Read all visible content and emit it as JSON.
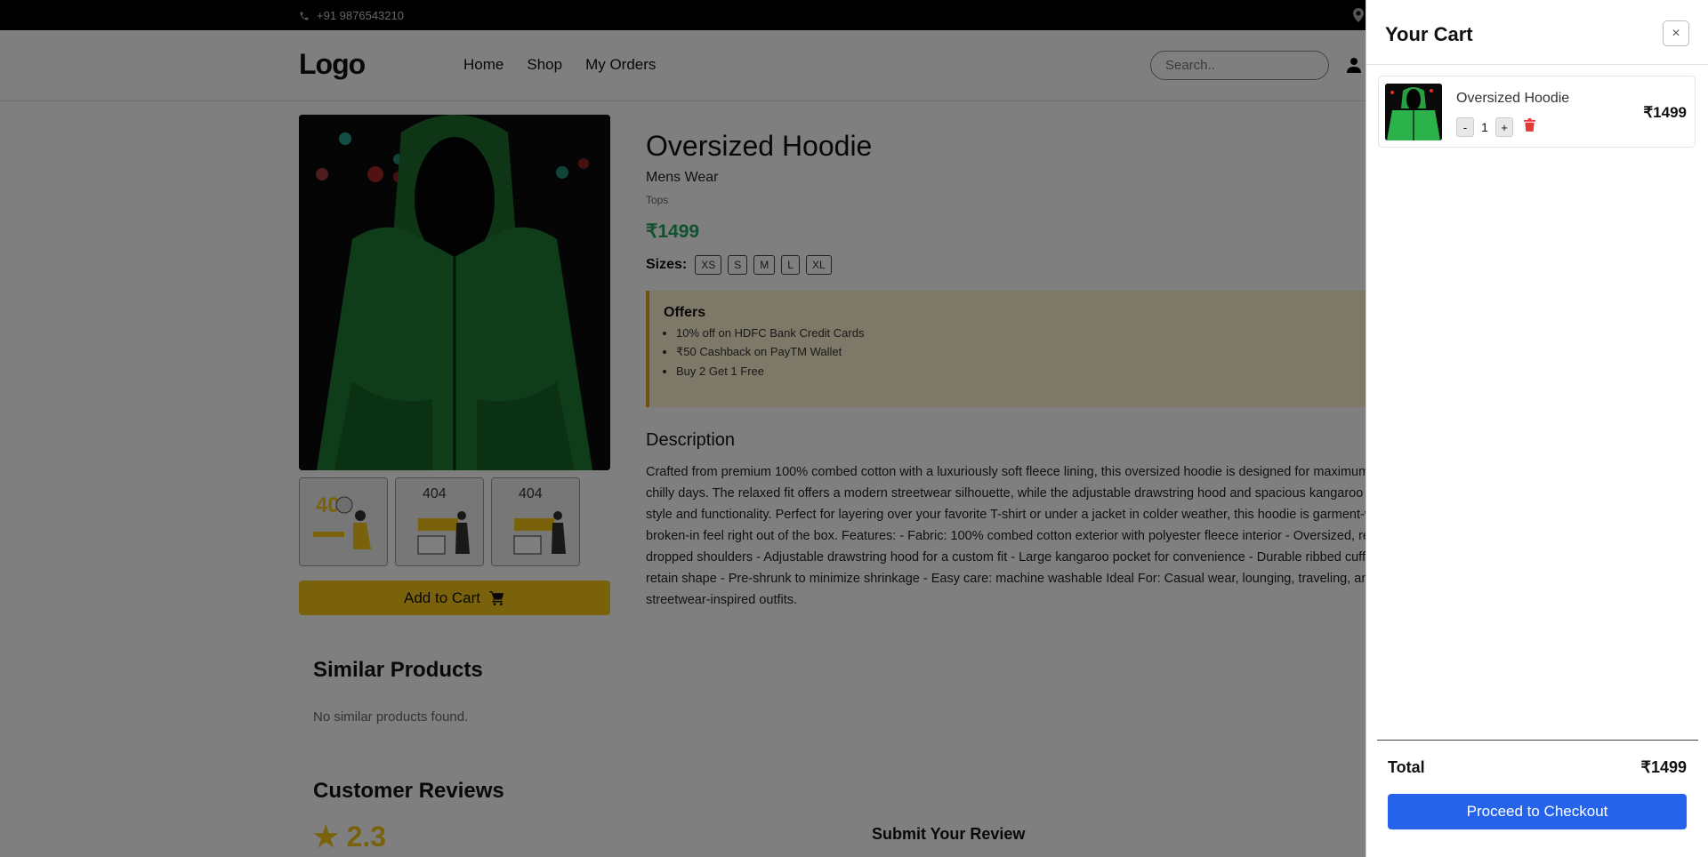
{
  "topbar": {
    "phone": "+91 9876543210"
  },
  "header": {
    "logo": "Logo",
    "nav": [
      "Home",
      "Shop",
      "My Orders"
    ],
    "search_placeholder": "Search.."
  },
  "product": {
    "title": "Oversized Hoodie",
    "category": "Mens Wear",
    "subcategory": "Tops",
    "price": "₹1499",
    "sizes_label": "Sizes:",
    "sizes": [
      "XS",
      "S",
      "M",
      "L",
      "XL"
    ],
    "add_to_cart": "Add to Cart",
    "offers_title": "Offers",
    "offers": [
      "10% off on HDFC Bank Credit Cards",
      "₹50 Cashback on PayTM Wallet",
      "Buy 2 Get 1 Free"
    ],
    "description_title": "Description",
    "description": "Crafted from premium 100% combed cotton with a luxuriously soft fleece lining, this oversized hoodie is designed for maximum comfort during chilly days. The relaxed fit offers a modern streetwear silhouette, while the adjustable drawstring hood and spacious kangaroo pocket add both style and functionality. Perfect for layering over your favorite T-shirt or under a jacket in colder weather, this hoodie is garment-washed for a broken-in feel right out of the box. Features: - Fabric: 100% combed cotton exterior with polyester fleece interior - Oversized, relaxed fit with dropped shoulders - Adjustable drawstring hood for a custom fit - Large kangaroo pocket for convenience - Durable ribbed cuffs and hem to retain shape - Pre-shrunk to minimize shrinkage - Easy care: machine washable Ideal For: Casual wear, lounging, traveling, and layering for streetwear-inspired outfits."
  },
  "similar": {
    "title": "Similar Products",
    "empty": "No similar products found."
  },
  "reviews": {
    "title": "Customer Reviews",
    "rating": "2.3",
    "submit_title": "Submit Your Review"
  },
  "cart": {
    "title": "Your Cart",
    "close": "×",
    "items": [
      {
        "name": "Oversized Hoodie",
        "qty": "1",
        "price": "₹1499",
        "minus": "-",
        "plus": "+"
      }
    ],
    "total_label": "Total",
    "total_value": "₹1499",
    "checkout": "Proceed to Checkout"
  },
  "colors": {
    "accent": "#f5c518",
    "price_green": "#22a061",
    "checkout_blue": "#2563eb",
    "delete_red": "#e53935"
  }
}
